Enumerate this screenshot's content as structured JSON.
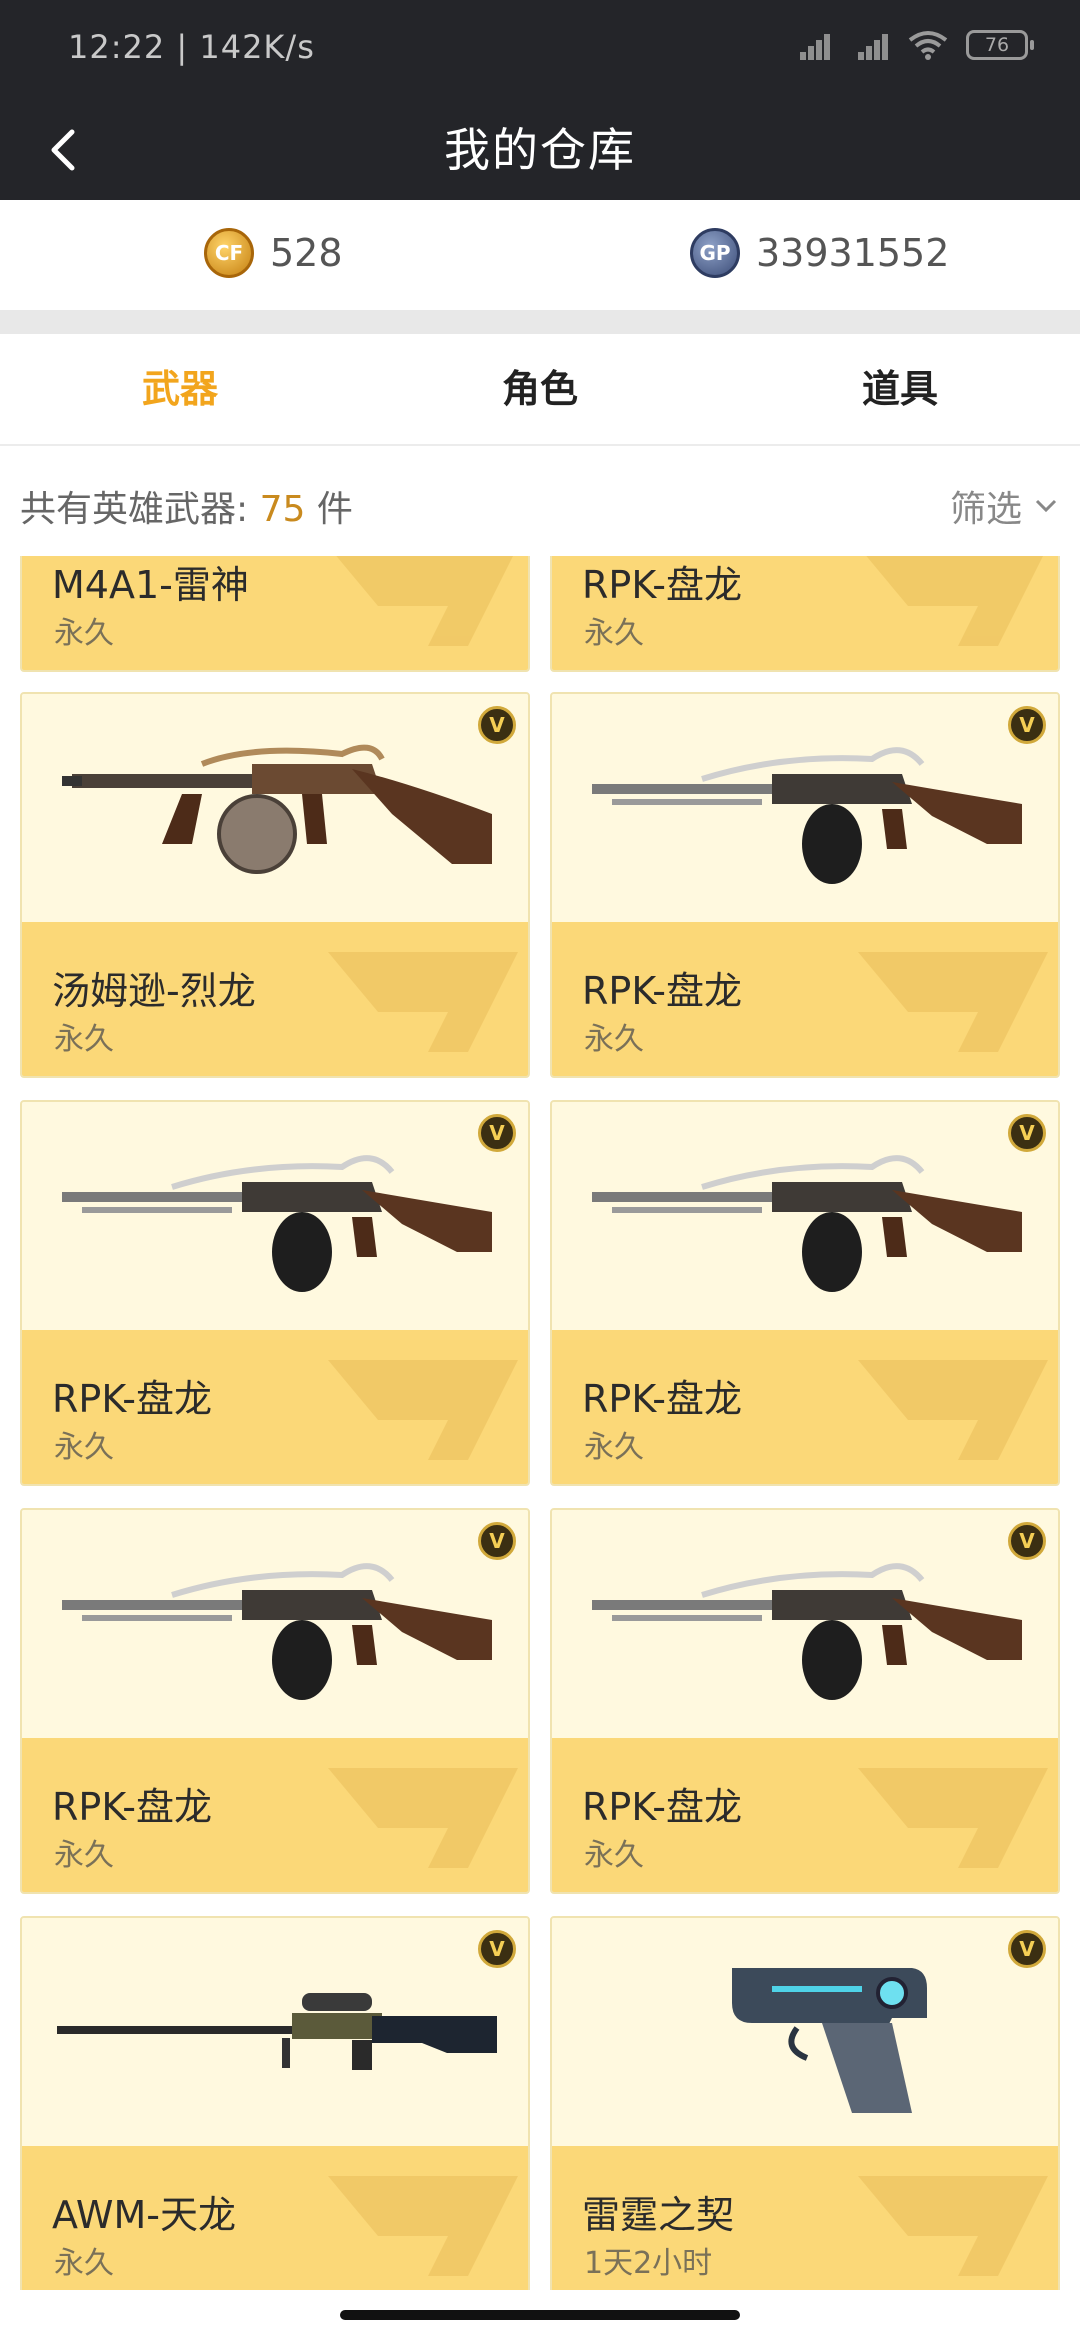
{
  "status_bar": {
    "time": "12:22 | 142K/s",
    "battery": "76"
  },
  "nav": {
    "title": "我的仓库"
  },
  "currency": {
    "cf_points": "528",
    "gp": "33931552"
  },
  "tabs": [
    {
      "label": "武器",
      "active": true
    },
    {
      "label": "角色",
      "active": false
    },
    {
      "label": "道具",
      "active": false
    }
  ],
  "summary": {
    "prefix": "共有英雄武器: ",
    "count": "75",
    "suffix": " 件",
    "filter_label": "筛选"
  },
  "items": [
    {
      "name": "M4A1-雷神",
      "duration": "永久"
    },
    {
      "name": "RPK-盘龙",
      "duration": "永久"
    },
    {
      "name": "汤姆逊-烈龙",
      "duration": "永久",
      "weapon": "tommy-gun"
    },
    {
      "name": "RPK-盘龙",
      "duration": "永久",
      "weapon": "rpk"
    },
    {
      "name": "RPK-盘龙",
      "duration": "永久",
      "weapon": "rpk"
    },
    {
      "name": "RPK-盘龙",
      "duration": "永久",
      "weapon": "rpk"
    },
    {
      "name": "RPK-盘龙",
      "duration": "永久",
      "weapon": "rpk"
    },
    {
      "name": "RPK-盘龙",
      "duration": "永久",
      "weapon": "rpk"
    },
    {
      "name": "AWM-天龙",
      "duration": "永久",
      "weapon": "sniper"
    },
    {
      "name": "雷霆之契",
      "duration": "1天2小时",
      "weapon": "pistol"
    }
  ],
  "badge_label": "V"
}
